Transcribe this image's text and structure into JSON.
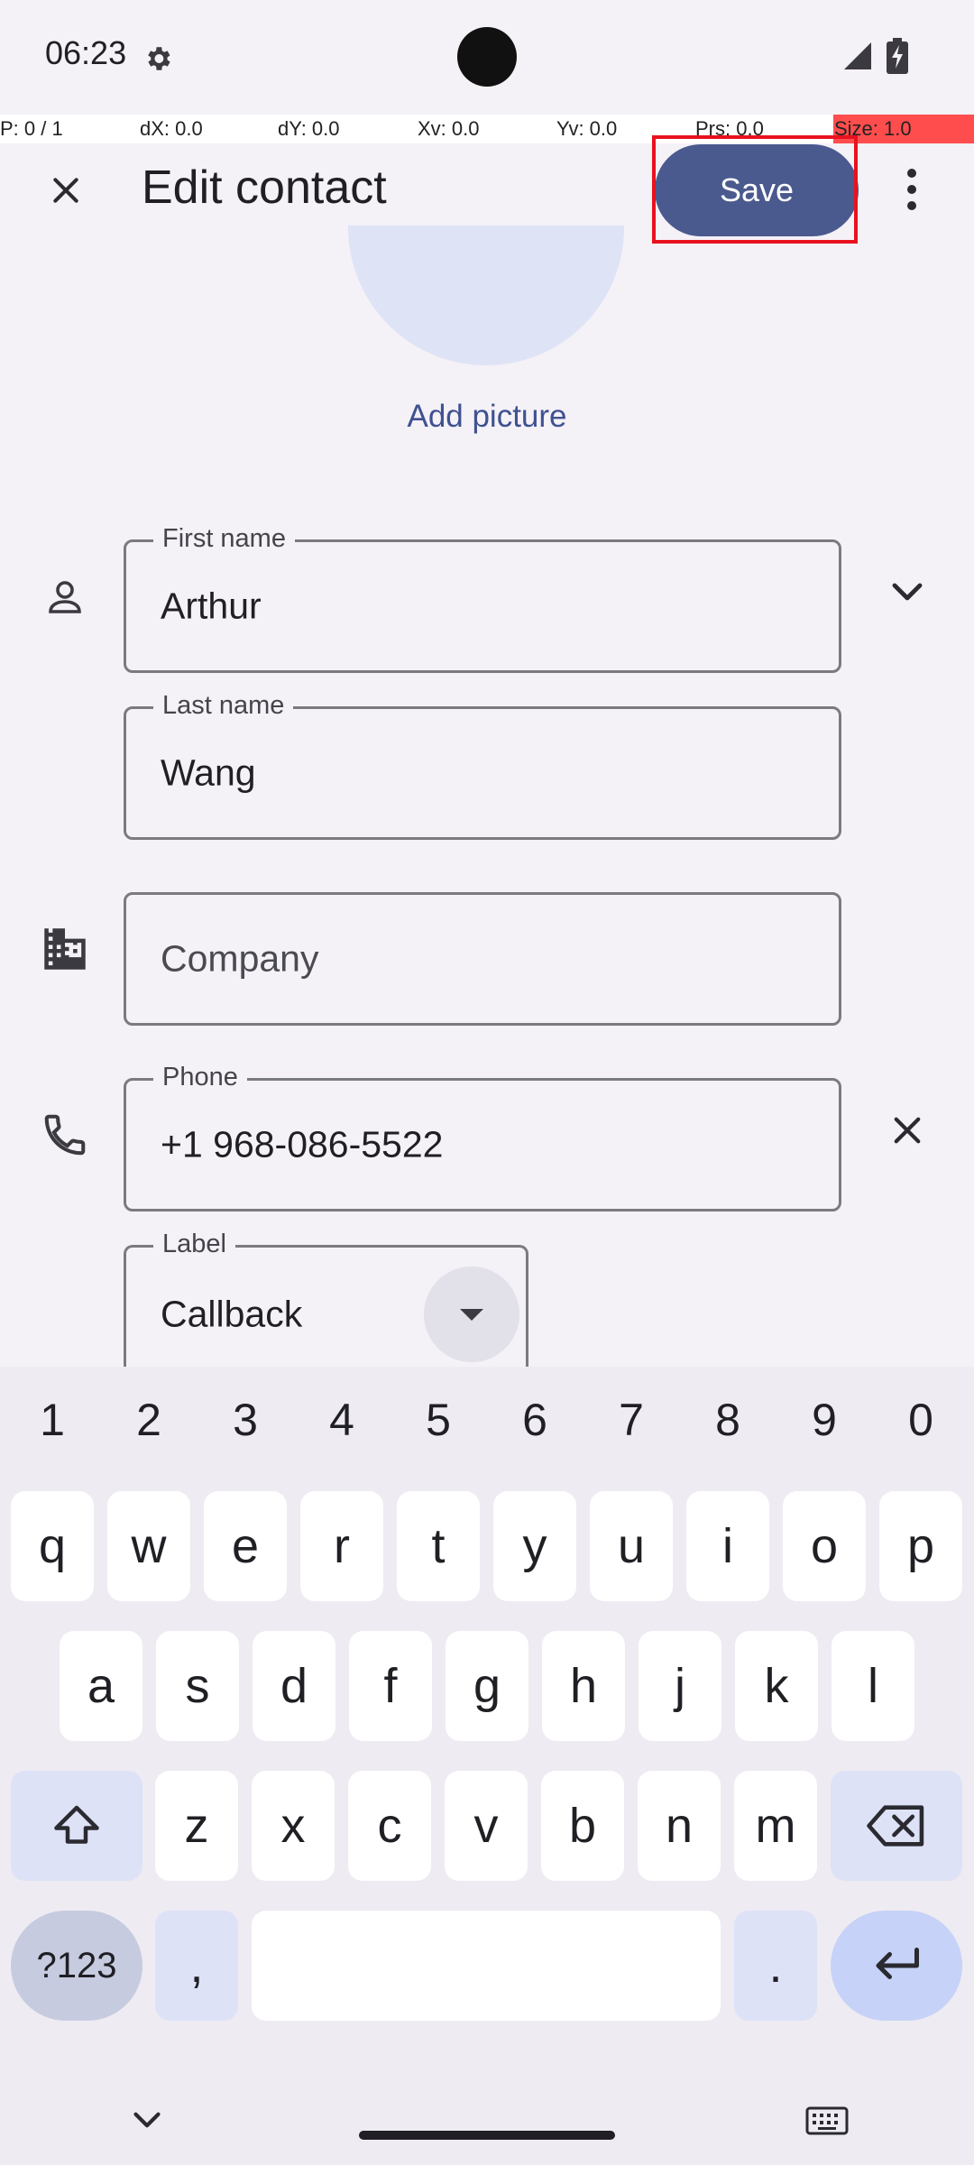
{
  "status_bar": {
    "time": "06:23",
    "icons": [
      "gear-icon",
      "signal-icon",
      "battery-icon"
    ]
  },
  "debug_overlay": {
    "p": "P: 0 / 1",
    "dx": "dX: 0.0",
    "dy": "dY: 0.0",
    "xv": "Xv: 0.0",
    "yv": "Yv: 0.0",
    "prs": "Prs: 0.0",
    "size": "Size: 1.0"
  },
  "app_bar": {
    "title": "Edit contact",
    "save_label": "Save",
    "close_icon": "close-icon",
    "more_icon": "more-vert-icon"
  },
  "avatar": {
    "add_picture_label": "Add picture"
  },
  "form": {
    "first_name": {
      "label": "First name",
      "value": "Arthur"
    },
    "last_name": {
      "label": "Last name",
      "value": "Wang"
    },
    "company": {
      "placeholder": "Company",
      "value": ""
    },
    "phone": {
      "label": "Phone",
      "value": "+1 968-086-5522"
    },
    "phone_label": {
      "label": "Label",
      "value": "Callback"
    }
  },
  "keyboard": {
    "number_row": [
      "1",
      "2",
      "3",
      "4",
      "5",
      "6",
      "7",
      "8",
      "9",
      "0"
    ],
    "row1": [
      "q",
      "w",
      "e",
      "r",
      "t",
      "y",
      "u",
      "i",
      "o",
      "p"
    ],
    "row2": [
      "a",
      "s",
      "d",
      "f",
      "g",
      "h",
      "j",
      "k",
      "l"
    ],
    "row3": [
      "z",
      "x",
      "c",
      "v",
      "b",
      "n",
      "m"
    ],
    "symbols_label": "?123",
    "comma": ",",
    "period": "."
  },
  "colors": {
    "accent": "#4a5a8f",
    "highlight": "#e8121e",
    "background": "#f4f1f7"
  }
}
